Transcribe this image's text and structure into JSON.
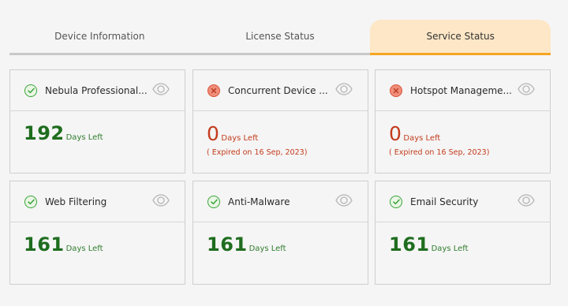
{
  "tabs": [
    {
      "label": "Device Information",
      "active": false
    },
    {
      "label": "License Status",
      "active": false
    },
    {
      "label": "Service Status",
      "active": true
    }
  ],
  "colors": {
    "active_tab_bg": "#fde7c6",
    "active_tab_underline": "#f5a623",
    "ok_green": "#1f6d1f",
    "error_red": "#c33b1c"
  },
  "cards": [
    {
      "name": "Nebula Professional...",
      "status": "ok",
      "status_icon": "check-circle-icon",
      "days": "192",
      "days_label": "Days Left",
      "expired": ""
    },
    {
      "name": "Concurrent Device ...",
      "status": "error",
      "status_icon": "x-circle-icon",
      "days": "0",
      "days_label": "Days Left",
      "expired": "( Expired on 16 Sep, 2023)"
    },
    {
      "name": "Hotspot Manageme...",
      "status": "error",
      "status_icon": "x-circle-icon",
      "days": "0",
      "days_label": "Days Left",
      "expired": "( Expired on 16 Sep, 2023)"
    },
    {
      "name": "Web Filtering",
      "status": "ok",
      "status_icon": "check-circle-icon",
      "days": "161",
      "days_label": "Days Left",
      "expired": ""
    },
    {
      "name": "Anti-Malware",
      "status": "ok",
      "status_icon": "check-circle-icon",
      "days": "161",
      "days_label": "Days Left",
      "expired": ""
    },
    {
      "name": "Email Security",
      "status": "ok",
      "status_icon": "check-circle-icon",
      "days": "161",
      "days_label": "Days Left",
      "expired": ""
    }
  ]
}
